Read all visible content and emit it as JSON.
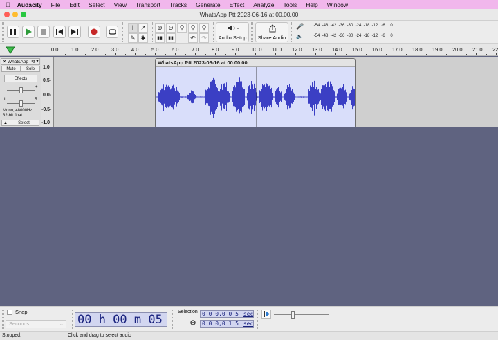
{
  "menubar": {
    "app": "Audacity",
    "items": [
      "File",
      "Edit",
      "Select",
      "View",
      "Transport",
      "Tracks",
      "Generate",
      "Effect",
      "Analyze",
      "Tools",
      "Help",
      "Window"
    ]
  },
  "window": {
    "title": "WhatsApp Ptt 2023-06-16 at 00.00.00"
  },
  "toolbar": {
    "audio_setup_label": "Audio Setup",
    "share_audio_label": "Share Audio",
    "meter_ticks": [
      "-54",
      "-48",
      "-42",
      "-36",
      "-30",
      "-24",
      "-18",
      "-12",
      "-6",
      "0"
    ]
  },
  "timeline": {
    "ticks": [
      "0.0",
      "1.0",
      "2.0",
      "3.0",
      "4.0",
      "5.0",
      "6.0",
      "7.0",
      "8.0",
      "9.0",
      "10.0",
      "11.0",
      "12.0",
      "13.0",
      "14.0",
      "15.0",
      "16.0",
      "17.0",
      "18.0",
      "19.0",
      "20.0",
      "21.0",
      "22.0"
    ]
  },
  "track": {
    "name": "WhatsApp Ptt",
    "mute_label": "Mute",
    "solo_label": "Solo",
    "effects_label": "Effects",
    "gain_left": "-",
    "gain_right": "+",
    "pan_left": "L",
    "pan_right": "R",
    "info_rate": "Mono, 48000Hz",
    "info_format": "32-bit float",
    "select_label": "Select",
    "ruler_labels": [
      "1.0",
      "0.5-",
      "0.0-",
      "-0.5-",
      "-1.0"
    ],
    "clip_title": "WhatsApp Ptt 2023-06-16 at 00.00.00",
    "clip_start_seconds": 5.0,
    "clip_end_seconds": 15.0
  },
  "bottom": {
    "snap_label": "Snap",
    "snap_unit": "Seconds",
    "time_display": "00 h 00 m 05 s",
    "selection_label": "Selection",
    "sel_start_value": "0 0 0,0 0 5",
    "sel_start_unit": "seconds",
    "sel_end_value": "0 0 0,0 1 5",
    "sel_end_unit": "seconds"
  },
  "status": {
    "state": "Stopped.",
    "hint": "Click and drag to select audio"
  },
  "colors": {
    "menubar_bg": "#f1b7ec",
    "background": "#5f6380",
    "waveform": "#3b3fc4",
    "clip_bg": "#d9defa",
    "play_green": "#2e9b3a",
    "record_red": "#c62828",
    "time_text": "#1a237e"
  }
}
